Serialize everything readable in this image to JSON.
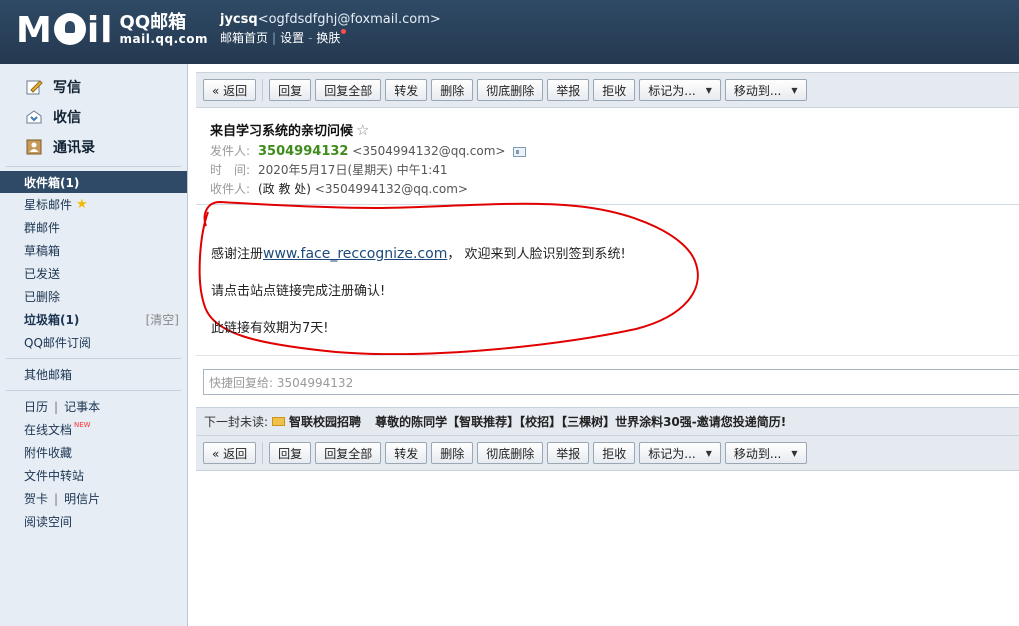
{
  "header": {
    "logo_text": "MOil",
    "brand_cn": "QQ邮箱",
    "brand_url": "mail.qq.com",
    "nickname": "jycsq",
    "email": "<ogfdsdfghj@foxmail.com>",
    "links": [
      "邮箱首页",
      "设置",
      "换肤"
    ]
  },
  "sidebar": {
    "actions": [
      {
        "label": "写信",
        "icon": "compose-icon"
      },
      {
        "label": "收信",
        "icon": "inbox-receive-icon"
      },
      {
        "label": "通讯录",
        "icon": "contacts-icon"
      }
    ],
    "active_folder": "收件箱(1)",
    "folders": [
      {
        "label": "星标邮件",
        "star": "★"
      },
      {
        "label": "群邮件"
      },
      {
        "label": "草稿箱"
      },
      {
        "label": "已发送"
      },
      {
        "label": "已删除"
      },
      {
        "label": "垃圾箱(1)",
        "extra": "[清空]"
      },
      {
        "label": "QQ邮件订阅"
      }
    ],
    "other_mail": "其他邮箱",
    "tools": {
      "calendar": "日历",
      "notebook": "记事本",
      "online_docs": "在线文档",
      "new_badge": "NEW",
      "attachments": "附件收藏",
      "file_transfer": "文件中转站",
      "greeting_card": "贺卡",
      "postcard": "明信片",
      "reading_space": "阅读空间"
    }
  },
  "toolbar": {
    "back": "« 返回",
    "reply": "回复",
    "reply_all": "回复全部",
    "forward": "转发",
    "delete": "删除",
    "delete_permanently": "彻底删除",
    "report": "举报",
    "reject": "拒收",
    "mark_as": "标记为...",
    "move_to": "移动到..."
  },
  "mail": {
    "subject": "来自学习系统的亲切问候",
    "star_glyph": "☆",
    "from_label": "发件人:",
    "from_name": "3504994132",
    "from_addr": "<3504994132@qq.com>",
    "time_label": "时　间:",
    "time_value": "2020年5月17日(星期天) 中午1:41",
    "to_label": "收件人:",
    "to_name": "(政 教 处)",
    "to_addr": "<3504994132@qq.com>",
    "body_prefix": "感谢注册",
    "body_link": "www.face_reccognize.com",
    "body_suffix": "， 欢迎来到人脸识别签到系统!",
    "body_line2": "请点击站点链接完成注册确认!",
    "body_line3": "此链接有效期为7天!"
  },
  "quick_reply": {
    "placeholder": "快捷回复给: 3504994132"
  },
  "next_unread": {
    "label": "下一封未读:",
    "from": "智联校园招聘",
    "subject": "尊敬的陈同学【智联推荐】【校招】【三棵树】世界涂料30强-邀请您投递简历!"
  }
}
